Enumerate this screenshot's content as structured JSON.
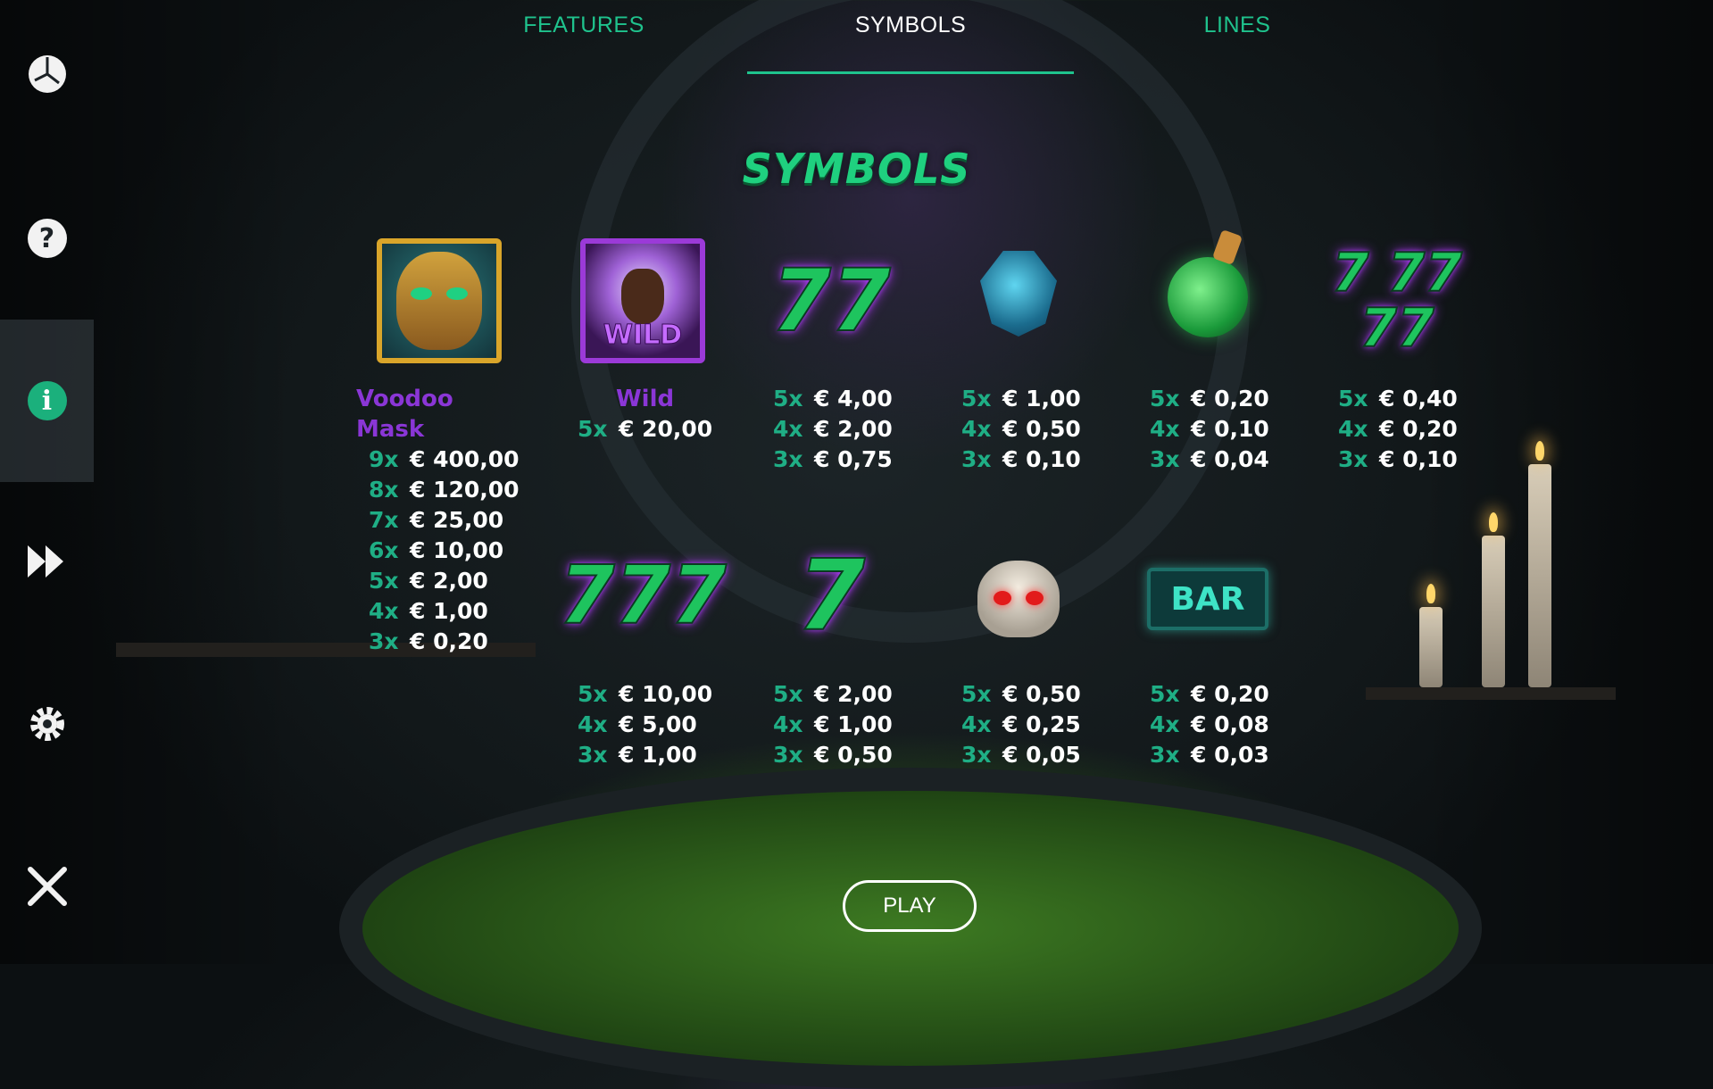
{
  "tabs": [
    {
      "label": "FEATURES",
      "active": false
    },
    {
      "label": "SYMBOLS",
      "active": true
    },
    {
      "label": "LINES",
      "active": false
    }
  ],
  "sidebar": [
    {
      "icon": "history-icon"
    },
    {
      "icon": "help-icon",
      "glyph": "?"
    },
    {
      "icon": "info-icon",
      "glyph": "i",
      "active": true
    },
    {
      "icon": "fast-forward-icon"
    },
    {
      "icon": "settings-icon"
    },
    {
      "icon": "close-icon"
    }
  ],
  "title": "SYMBOLS",
  "symbols": {
    "voodoo_mask": {
      "name_line1": "Voodoo",
      "name_line2": "Mask",
      "pays": [
        {
          "count": "9x",
          "amount": "€ 400,00"
        },
        {
          "count": "8x",
          "amount": "€ 120,00"
        },
        {
          "count": "7x",
          "amount": "€ 25,00"
        },
        {
          "count": "6x",
          "amount": "€ 10,00"
        },
        {
          "count": "5x",
          "amount": "€ 2,00"
        },
        {
          "count": "4x",
          "amount": "€ 1,00"
        },
        {
          "count": "3x",
          "amount": "€ 0,20"
        }
      ]
    },
    "wild": {
      "name": "Wild",
      "badge": "WILD",
      "pays": [
        {
          "count": "5x",
          "amount": "€ 20,00"
        }
      ]
    },
    "double_seven": {
      "glyph": "77",
      "pays": [
        {
          "count": "5x",
          "amount": "€ 4,00"
        },
        {
          "count": "4x",
          "amount": "€ 2,00"
        },
        {
          "count": "3x",
          "amount": "€ 0,75"
        }
      ]
    },
    "blue_gem": {
      "pays": [
        {
          "count": "5x",
          "amount": "€ 1,00"
        },
        {
          "count": "4x",
          "amount": "€ 0,50"
        },
        {
          "count": "3x",
          "amount": "€ 0,10"
        }
      ]
    },
    "potion": {
      "pays": [
        {
          "count": "5x",
          "amount": "€ 0,20"
        },
        {
          "count": "4x",
          "amount": "€ 0,10"
        },
        {
          "count": "3x",
          "amount": "€ 0,04"
        }
      ]
    },
    "any_seven": {
      "glyph_top": "7 77",
      "glyph_bottom": "77",
      "pays": [
        {
          "count": "5x",
          "amount": "€ 0,40"
        },
        {
          "count": "4x",
          "amount": "€ 0,20"
        },
        {
          "count": "3x",
          "amount": "€ 0,10"
        }
      ]
    },
    "triple_seven": {
      "glyph": "777",
      "pays": [
        {
          "count": "5x",
          "amount": "€ 10,00"
        },
        {
          "count": "4x",
          "amount": "€ 5,00"
        },
        {
          "count": "3x",
          "amount": "€ 1,00"
        }
      ]
    },
    "single_seven": {
      "glyph": "7",
      "pays": [
        {
          "count": "5x",
          "amount": "€ 2,00"
        },
        {
          "count": "4x",
          "amount": "€ 1,00"
        },
        {
          "count": "3x",
          "amount": "€ 0,50"
        }
      ]
    },
    "skull": {
      "pays": [
        {
          "count": "5x",
          "amount": "€ 0,50"
        },
        {
          "count": "4x",
          "amount": "€ 0,25"
        },
        {
          "count": "3x",
          "amount": "€ 0,05"
        }
      ]
    },
    "bar": {
      "glyph": "BAR",
      "pays": [
        {
          "count": "5x",
          "amount": "€ 0,20"
        },
        {
          "count": "4x",
          "amount": "€ 0,08"
        },
        {
          "count": "3x",
          "amount": "€ 0,03"
        }
      ]
    }
  },
  "play_label": "PLAY",
  "colors": {
    "accent": "#1fc38d",
    "wild_purple": "#8a36d6",
    "count_teal": "#1fae85"
  }
}
